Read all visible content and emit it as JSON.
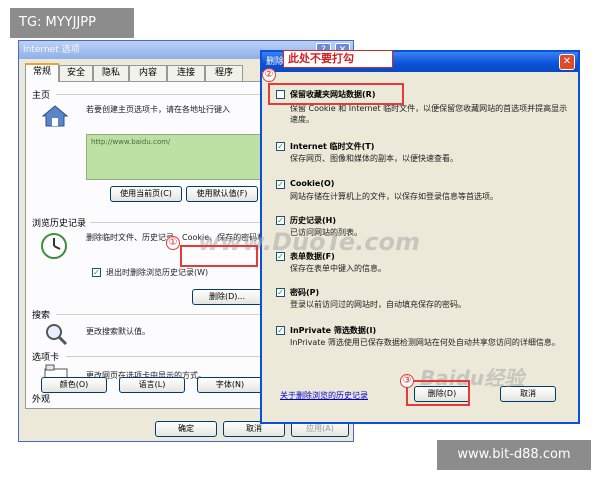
{
  "overlays": {
    "top_left_tag": "TG: MYYJJPP",
    "bottom_right_tag": "www.bit-d88.com",
    "watermark_center": "www.DuoTe.com",
    "watermark_bottom": "Baidu经验"
  },
  "internet_options": {
    "title": "Internet 选项",
    "tabs": [
      "常规",
      "安全",
      "隐私",
      "内容",
      "连接",
      "程序"
    ],
    "homepage": {
      "label": "主页",
      "description": "若要创建主页选项卡，请在各地址行键入",
      "url": "http://www.baidu.com/",
      "buttons": [
        "使用当前页(C)",
        "使用默认值(F)"
      ]
    },
    "history": {
      "label": "浏览历史记录",
      "description": "删除临时文件、历史记录、Cookie、保存的密码和网页表单信息。",
      "checkbox_label": "退出时删除浏览历史记录(W)",
      "delete_button": "删除(D)..."
    },
    "search": {
      "label": "搜索",
      "description": "更改搜索默认值。"
    },
    "tabs_section": {
      "label": "选项卡",
      "description": "更改网页在选项卡中显示的方式。"
    },
    "appearance": {
      "label": "外观",
      "buttons": [
        "颜色(O)",
        "语言(L)",
        "字体(N)"
      ]
    },
    "footer_buttons": [
      "确定",
      "取消",
      "应用(A)"
    ]
  },
  "delete_dialog": {
    "title": "删除浏览的历史记录",
    "callout": "此处不要打勾",
    "options": [
      {
        "title": "保留收藏夹网站数据(R)",
        "desc": "保留 Cookie 和 Internet 临时文件，以便保留您收藏网站的首选项并提高显示速度。",
        "checked": false
      },
      {
        "title": "Internet 临时文件(T)",
        "desc": "保存网页、图像和媒体的副本，以便快速查看。",
        "checked": true
      },
      {
        "title": "Cookie(O)",
        "desc": "网站存储在计算机上的文件，以保存如登录信息等首选项。",
        "checked": true
      },
      {
        "title": "历史记录(H)",
        "desc": "已访问网站的列表。",
        "checked": true
      },
      {
        "title": "表单数据(F)",
        "desc": "保存在表单中键入的信息。",
        "checked": true
      },
      {
        "title": "密码(P)",
        "desc": "登录以前访问过的网站时，自动填充保存的密码。",
        "checked": true
      },
      {
        "title": "InPrivate 筛选数据(I)",
        "desc": "InPrivate 筛选使用已保存数据检测网站在何处自动共享您访问的详细信息。",
        "checked": true
      }
    ],
    "link": "关于删除浏览的历史记录",
    "buttons": [
      "删除(D)",
      "取消"
    ]
  },
  "steps": [
    "①",
    "②",
    "③"
  ],
  "colors": {
    "highlight": "#e53a3a",
    "xp_blue": "#0a52d9",
    "checkmark": "#21a121"
  }
}
